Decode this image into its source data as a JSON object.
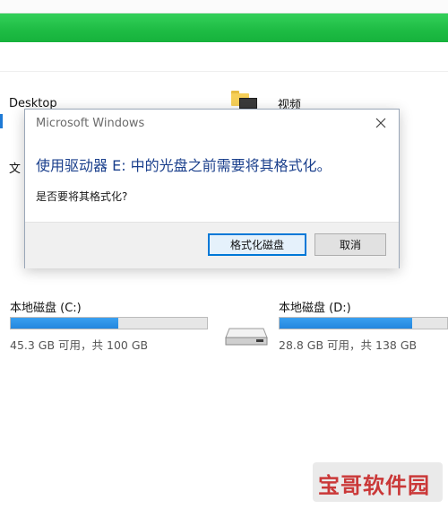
{
  "progress": {
    "fraction": 1.0,
    "color": "#1fbd45"
  },
  "explorer": {
    "desktop_label": "Desktop",
    "video_label": "视频",
    "documents_partial": "文"
  },
  "dialog": {
    "title": "Microsoft Windows",
    "message": "使用驱动器 E: 中的光盘之前需要将其格式化。",
    "question": "是否要将其格式化?",
    "format_button": "格式化磁盘",
    "cancel_button": "取消",
    "accent_color": "#0078d7"
  },
  "drives": [
    {
      "label": "本地磁盘 (C:)",
      "space_text": "45.3 GB 可用，共 100 GB",
      "used_fraction": 0.547
    },
    {
      "label": "本地磁盘 (D:)",
      "space_text": "28.8 GB 可用，共 138 GB",
      "used_fraction": 0.791
    }
  ],
  "watermark": {
    "text": "宝哥软件园"
  }
}
